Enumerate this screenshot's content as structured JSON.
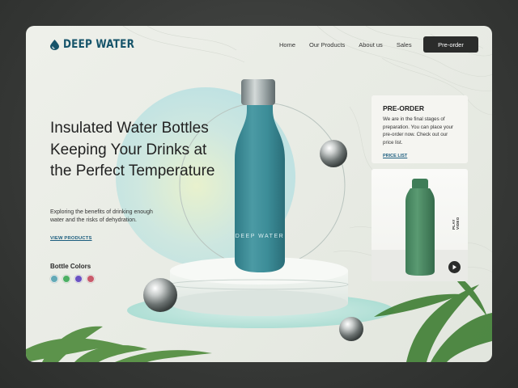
{
  "brand": {
    "name": "DEEP WATER",
    "bottle_text": "DEEP WATER"
  },
  "nav": {
    "items": [
      "Home",
      "Our Products",
      "About us",
      "Sales"
    ],
    "cta_label": "Pre-order"
  },
  "hero": {
    "headline": "Insulated Water Bottles Keeping Your Drinks at the Perfect Temperature",
    "subtext": "Exploring the benefits of drinking enough water and the risks of dehydration.",
    "link_label": "VIEW PRODUCTS"
  },
  "bottle_colors": {
    "label": "Bottle Colors",
    "swatches": [
      "#63a9b6",
      "#4caf63",
      "#6a52c2",
      "#c85a6a"
    ]
  },
  "preorder_card": {
    "title": "PRE-ORDER",
    "text": "We are in the final stages of preparation. You can place your pre-order now. Check out our price list.",
    "link_label": "PRICE LIST"
  },
  "video_card": {
    "label": "PLAY VIDEO"
  },
  "colors": {
    "brand": "#16546a",
    "bottle_teal": "#3b8c96",
    "button_dark": "#2b2c2b",
    "green_bottle": "#4a8a63"
  }
}
